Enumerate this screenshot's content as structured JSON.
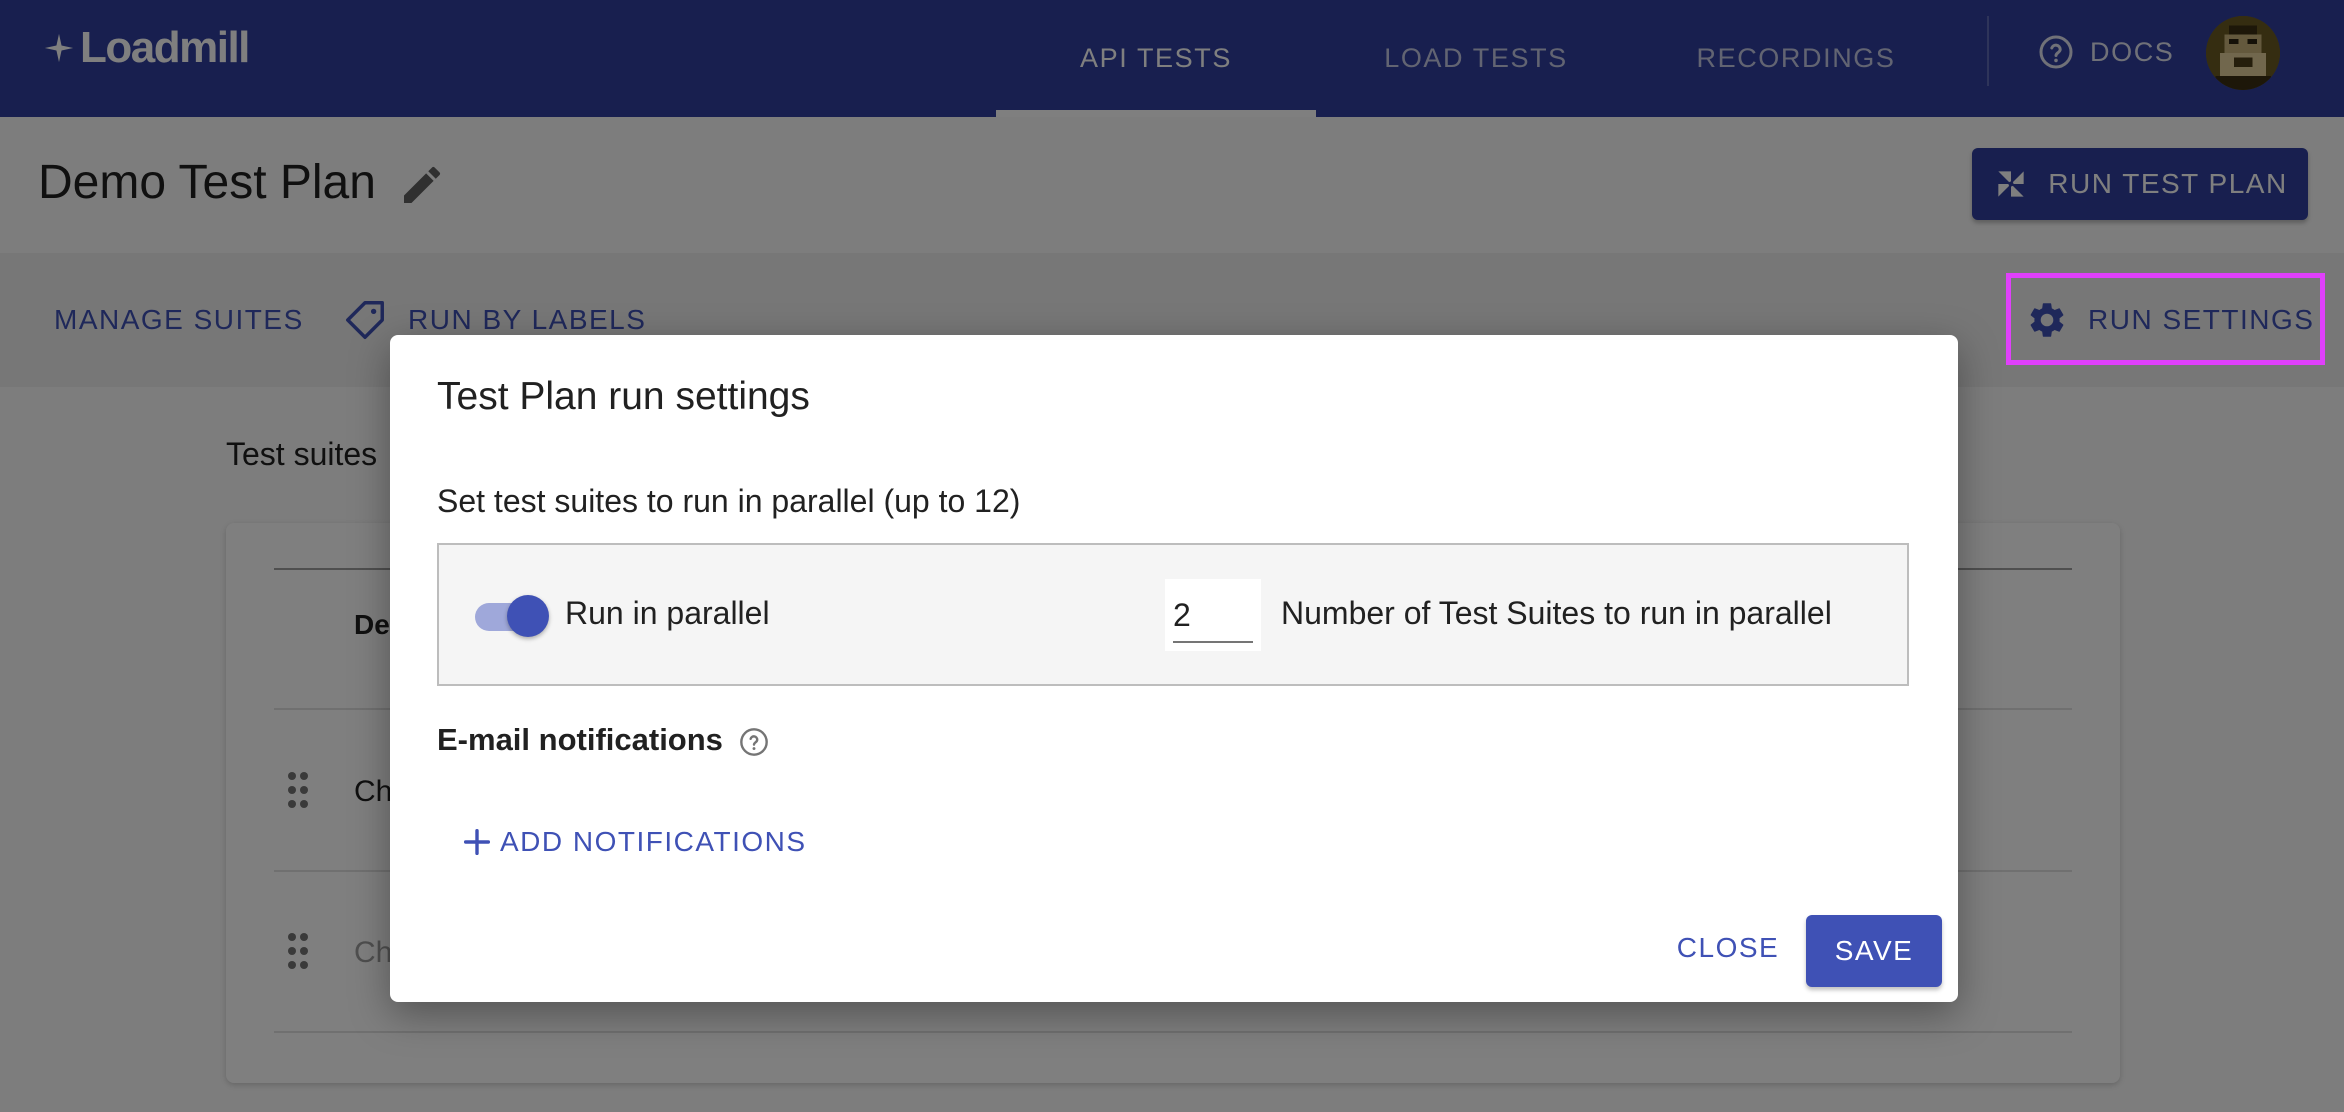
{
  "app": {
    "logo": "Loadmill"
  },
  "nav": {
    "tabs": [
      {
        "label": "API TESTS",
        "active": true
      },
      {
        "label": "LOAD TESTS",
        "active": false
      },
      {
        "label": "RECORDINGS",
        "active": false
      }
    ],
    "docs_label": "DOCS"
  },
  "header": {
    "title": "Demo Test Plan",
    "run_button": "RUN TEST PLAN"
  },
  "toolbar": {
    "manage_suites": "MANAGE SUITES",
    "run_by_labels": "RUN BY LABELS",
    "run_settings": "RUN SETTINGS"
  },
  "content": {
    "section_label": "Test suites",
    "column_header": "De",
    "rows": [
      {
        "text": "Ch"
      },
      {
        "text": "Ch"
      }
    ]
  },
  "dialog": {
    "title": "Test Plan run settings",
    "subtitle": "Set test suites to run in parallel (up to 12)",
    "parallel_label": "Run in parallel",
    "parallel_enabled": true,
    "parallel_count": "2",
    "parallel_count_label": "Number of Test Suites to run in parallel",
    "email_title": "E-mail notifications",
    "add_notifications": "ADD NOTIFICATIONS",
    "close": "CLOSE",
    "save": "SAVE"
  },
  "colors": {
    "primary": "#303f9f",
    "accent": "#3f51b5",
    "highlight": "#e040fb"
  },
  "icons": [
    "sparkle-icon",
    "help-circle-icon",
    "pencil-icon",
    "pinwheel-icon",
    "tag-icon",
    "gear-icon",
    "drag-handle-icon",
    "plus-icon"
  ]
}
